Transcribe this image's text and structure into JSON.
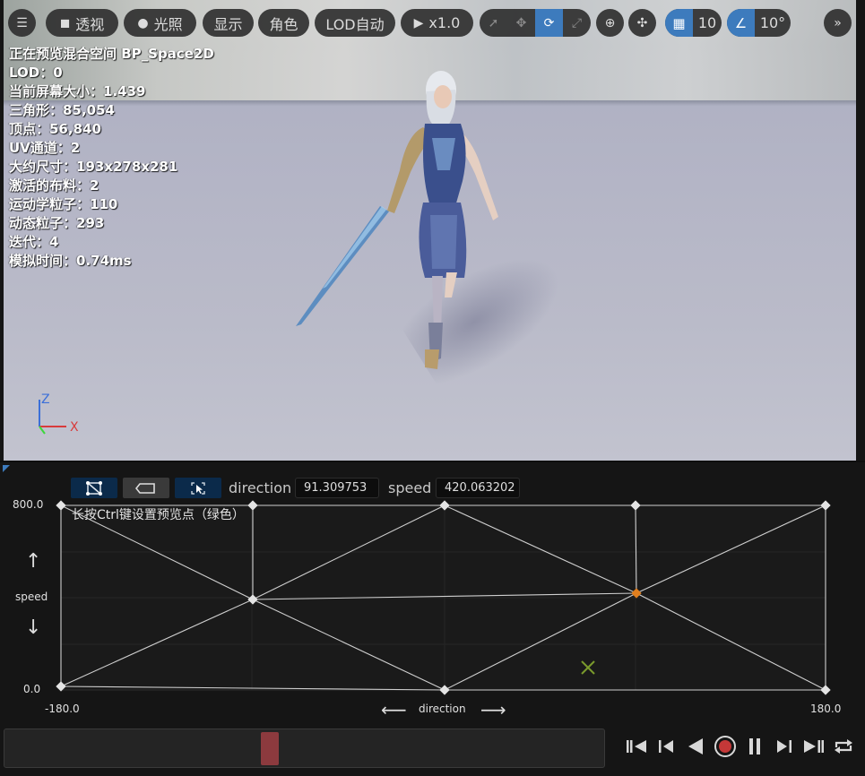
{
  "toolbar": {
    "menu_icon": "hamburger-icon",
    "perspective_label": "透视",
    "lighting_label": "光照",
    "show_label": "显示",
    "character_label": "角色",
    "lod_label": "LOD自动",
    "playback_speed_label": "x1.0",
    "grid_snap_value": "10",
    "rotation_snap_value": "10°",
    "transform_modes": [
      "select-icon",
      "move-icon",
      "rotate-icon",
      "scale-icon"
    ],
    "active_transform_mode": "rotate-icon"
  },
  "stats": {
    "lines": [
      "正在预览混合空间 BP_Space2D",
      "LOD：0",
      "当前屏幕大小：1.439",
      "三角形：85,054",
      "顶点：56,840",
      "UV通道：2",
      "大约尺寸：193x278x281",
      "激活的布料：2",
      "运动学粒子：110",
      "动态粒子：293",
      "迭代：4",
      "模拟时间：0.74ms"
    ]
  },
  "gizmo": {
    "z": "Z",
    "x": "X"
  },
  "blendspace": {
    "direction_label": "direction",
    "direction_value": "91.309753",
    "speed_label": "speed",
    "speed_value": "420.063202",
    "hint": "长按Ctrl键设置预览点（绿色）",
    "y_axis_label": "speed",
    "x_axis_label": "direction",
    "y_max": "800.0",
    "y_min": "0.0",
    "x_min": "-180.0",
    "x_max": "180.0",
    "accent_color": "#e07f1f",
    "preview_color": "#7a9a2c"
  },
  "timeline": {
    "scrub_position": 0.44
  },
  "transport": [
    "skip-to-start-icon",
    "step-back-icon",
    "play-reverse-icon",
    "record-icon",
    "pause-icon",
    "step-forward-icon",
    "skip-to-end-icon",
    "loop-icon"
  ]
}
